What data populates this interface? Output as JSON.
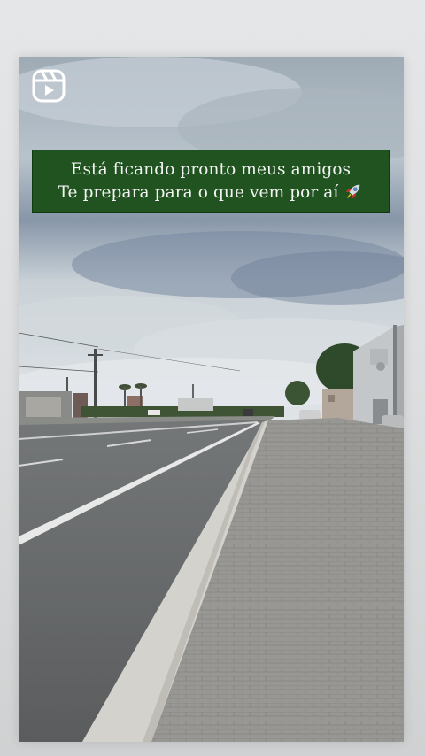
{
  "story": {
    "caption_line_1": "Está ficando pronto meus amigos",
    "caption_line_2": "Te prepara para o que vem por aí",
    "caption_emoji": "rocket-icon",
    "badge_icon": "reels-icon"
  },
  "colors": {
    "caption_background": "#20531f",
    "caption_text": "#f4f4f4",
    "page_background": "#dcdedf"
  }
}
